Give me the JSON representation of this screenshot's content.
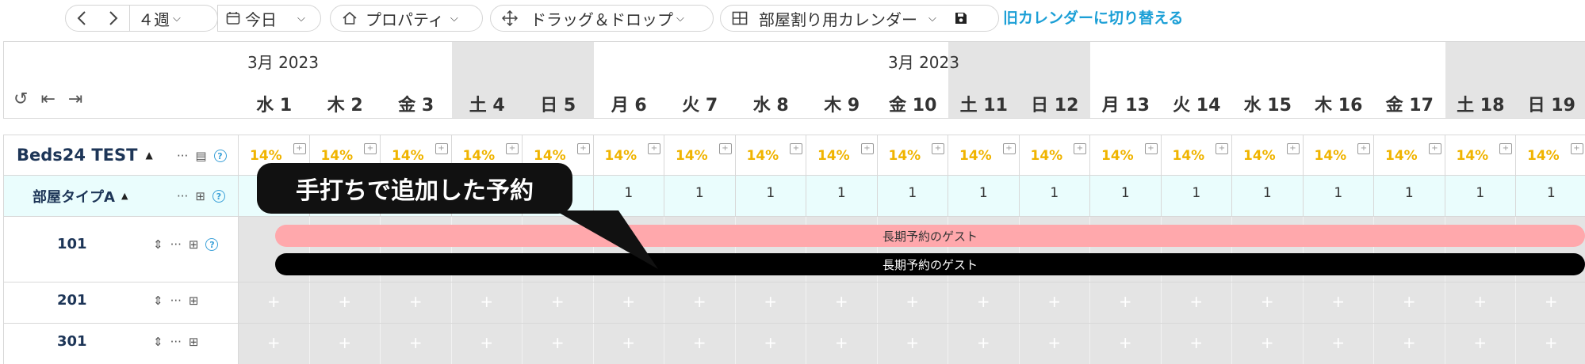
{
  "toolbar": {
    "prev_icon": "chevron-left-icon",
    "next_icon": "chevron-right-icon",
    "weeks": "４週",
    "today": "今日",
    "property": "プロパティ",
    "drag_drop": "ドラッグ＆ドロップ",
    "calendar": "部屋割り用カレンダー",
    "old_calendar": "旧カレンダーに切り替える"
  },
  "header": {
    "month_left": "3月 2023",
    "month_right": "3月 2023",
    "days": [
      {
        "label": "水 1",
        "weekend": false
      },
      {
        "label": "木 2",
        "weekend": false
      },
      {
        "label": "金 3",
        "weekend": false
      },
      {
        "label": "土 4",
        "weekend": true
      },
      {
        "label": "日 5",
        "weekend": true
      },
      {
        "label": "月 6",
        "weekend": false
      },
      {
        "label": "火 7",
        "weekend": false
      },
      {
        "label": "水 8",
        "weekend": false
      },
      {
        "label": "木 9",
        "weekend": false
      },
      {
        "label": "金 10",
        "weekend": false
      },
      {
        "label": "土 11",
        "weekend": true
      },
      {
        "label": "日 12",
        "weekend": true
      },
      {
        "label": "月 13",
        "weekend": false
      },
      {
        "label": "火 14",
        "weekend": false
      },
      {
        "label": "水 15",
        "weekend": false
      },
      {
        "label": "木 16",
        "weekend": false
      },
      {
        "label": "金 17",
        "weekend": false
      },
      {
        "label": "土 18",
        "weekend": true
      },
      {
        "label": "日 19",
        "weekend": true
      }
    ]
  },
  "property": {
    "name": "Beds24 TEST",
    "occupancy": "14%"
  },
  "room_type": {
    "name": "部屋タイプA",
    "availability": "1"
  },
  "rooms": [
    {
      "name": "101"
    },
    {
      "name": "201"
    },
    {
      "name": "301"
    }
  ],
  "bookings": [
    {
      "label": "長期予約のゲスト",
      "color": "#ffa8ac"
    },
    {
      "label": "長期予約のゲスト",
      "color": "#000000"
    }
  ],
  "callout": "手打ちで追加した予約",
  "cell_plus": "+"
}
